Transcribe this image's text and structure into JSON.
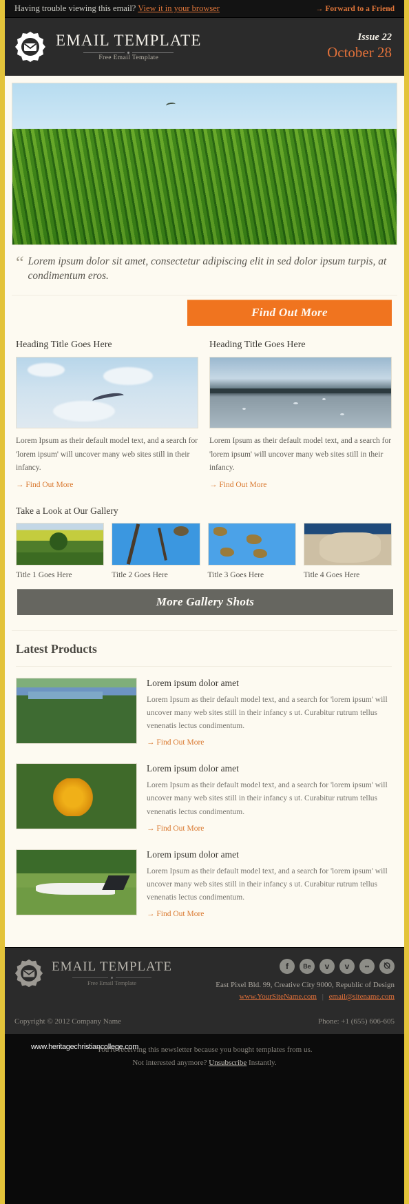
{
  "colors": {
    "accent_orange": "#e2713a",
    "border_gold": "#e3c33a",
    "dark_bg": "#2b2b2b",
    "body_bg": "#fdfaf1",
    "grey_button": "#666660"
  },
  "preheader": {
    "text": "Having trouble viewing this email?",
    "browser_link": "View it in your browser",
    "forward_arrow": "→",
    "forward_link": "Forward to a Friend"
  },
  "masthead": {
    "logo_icon": "envelope-badge-icon",
    "title": "EMAIL TEMPLATE",
    "subtitle": "Free Email Template",
    "issue": "Issue 22",
    "date": "October 28"
  },
  "hero": {
    "image_alt": "green-grass-field-photo"
  },
  "quote": {
    "mark": "“",
    "text": "Lorem ipsum dolor sit amet, consectetur adipiscing elit in sed dolor ipsum turpis, at condimentum eros.",
    "button_label": "Find Out More"
  },
  "two_column": [
    {
      "heading": "Heading Title Goes Here",
      "image_alt": "seagull-flying-photo",
      "text": "Lorem Ipsum as their default model text, and a search for 'lorem ipsum' will uncover many web sites still in their infancy.",
      "link_arrow": "→",
      "link_label": "Find Out More"
    },
    {
      "heading": "Heading Title Goes Here",
      "image_alt": "sea-horizon-photo",
      "text": "Lorem Ipsum as their default model text, and a search for 'lorem ipsum' will uncover many web sites still in their infancy.",
      "link_arrow": "→",
      "link_label": "Find Out More"
    }
  ],
  "gallery": {
    "heading": "Take a Look at Our Gallery",
    "items": [
      {
        "title": "Title 1 Goes Here",
        "image_alt": "field-with-tree-photo"
      },
      {
        "title": "Title 2 Goes Here",
        "image_alt": "bird-on-blossom-branch-photo"
      },
      {
        "title": "Title 3 Goes Here",
        "image_alt": "seed-pods-sky-photo"
      },
      {
        "title": "Title 4 Goes Here",
        "image_alt": "rock-formation-photo"
      }
    ],
    "button_label": "More Gallery Shots"
  },
  "products": {
    "heading": "Latest Products",
    "items": [
      {
        "title": "Lorem ipsum dolor amet",
        "text": "Lorem Ipsum as their default model text, and a search for 'lorem ipsum' will uncover many web sites still in their infancy s ut. Curabitur rutrum tellus venenatis lectus condimentum.",
        "link_arrow": "→",
        "link_label": "Find Out More",
        "image_alt": "lake-and-trees-photo"
      },
      {
        "title": "Lorem ipsum dolor amet",
        "text": "Lorem Ipsum as their default model text, and a search for 'lorem ipsum' will uncover many web sites still in their infancy s ut. Curabitur rutrum tellus venenatis lectus condimentum.",
        "link_arrow": "→",
        "link_label": "Find Out More",
        "image_alt": "yellow-dandelion-photo"
      },
      {
        "title": "Lorem ipsum dolor amet",
        "text": "Lorem Ipsum as their default model text, and a search for 'lorem ipsum' will uncover many web sites still in their infancy s ut. Curabitur rutrum tellus venenatis lectus condimentum.",
        "link_arrow": "→",
        "link_label": "Find Out More",
        "image_alt": "airplane-on-grass-photo"
      }
    ]
  },
  "footer": {
    "logo_icon": "envelope-badge-icon",
    "title": "EMAIL TEMPLATE",
    "subtitle": "Free Email Template",
    "socials": [
      {
        "name": "facebook-icon",
        "glyph": "f"
      },
      {
        "name": "behance-icon",
        "glyph": "Be"
      },
      {
        "name": "twitter-icon",
        "glyph": "ᴠ"
      },
      {
        "name": "vimeo-icon",
        "glyph": "v"
      },
      {
        "name": "flickr-icon",
        "glyph": "••"
      },
      {
        "name": "rss-icon",
        "glyph": "⦰"
      }
    ],
    "address": "East Pixel Bld. 99, Creative City 9000, Republic of Design",
    "website": "www.YourSiteName.com",
    "separator": "|",
    "email": "email@sitename.com",
    "copyright": "Copyright © 2012 Company Name",
    "phone": "Phone: +1 (655) 606-605"
  },
  "legal": {
    "line1": "You're receiving this newsletter because you bought templates from us.",
    "line2_pre": "Not interested anymore?",
    "unsubscribe": "Unsubscribe",
    "line2_post": "Instantly.",
    "watermark": "www.heritagechristiancollege.com"
  }
}
